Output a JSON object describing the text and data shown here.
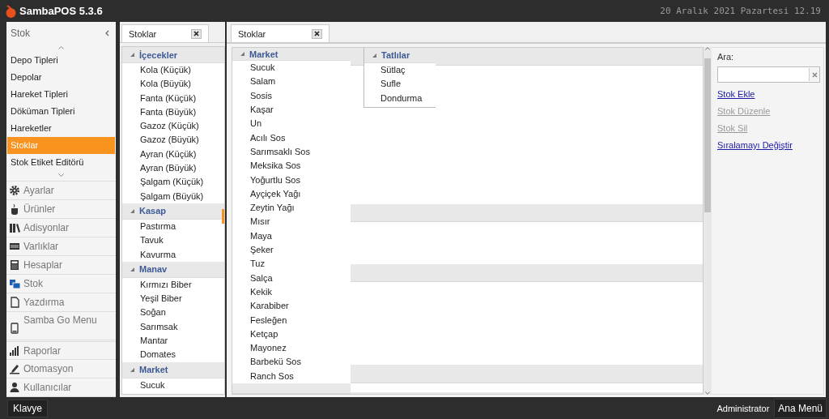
{
  "app": {
    "title": "SambaPOS 5.3.6",
    "datetime": "20 Aralık 2021 Pazartesi 12.19"
  },
  "sidebar": {
    "title": "Stok",
    "items": [
      {
        "label": "Depo Tipleri",
        "selected": false
      },
      {
        "label": "Depolar",
        "selected": false
      },
      {
        "label": "Hareket Tipleri",
        "selected": false
      },
      {
        "label": "Döküman Tipleri",
        "selected": false
      },
      {
        "label": "Hareketler",
        "selected": false
      },
      {
        "label": "Stoklar",
        "selected": true
      },
      {
        "label": "Stok Etiket Editörü",
        "selected": false
      }
    ],
    "nav": [
      {
        "label": "Ayarlar",
        "selected": false
      },
      {
        "label": "Ürünler",
        "selected": false
      },
      {
        "label": "Adisyonlar",
        "selected": false
      },
      {
        "label": "Varlıklar",
        "selected": false
      },
      {
        "label": "Hesaplar",
        "selected": false
      },
      {
        "label": "Stok",
        "selected": true
      },
      {
        "label": "Yazdırma",
        "selected": false
      },
      {
        "label": "Samba Go Menu",
        "selected": false
      },
      {
        "label": "Raporlar",
        "selected": false
      },
      {
        "label": "Otomasyon",
        "selected": false
      },
      {
        "label": "Kullanıcılar",
        "selected": false
      }
    ]
  },
  "left_panel": {
    "tab": {
      "label": "Stoklar"
    },
    "groups": [
      {
        "name": "İçecekler",
        "expanded": true,
        "items": [
          "Kola (Küçük)",
          "Kola (Büyük)",
          "Fanta (Küçük)",
          "Fanta (Büyük)",
          "Gazoz (Küçük)",
          "Gazoz (Büyük)",
          "Ayran (Küçük)",
          "Ayran (Büyük)",
          "Şalgam (Küçük)",
          "Şalgam (Büyük)"
        ]
      },
      {
        "name": "Kasap",
        "expanded": true,
        "items": [
          "Pastırma",
          "Tavuk",
          "Kavurma"
        ]
      },
      {
        "name": "Manav",
        "expanded": true,
        "items": [
          "Kırmızı Biber",
          "Yeşil Biber",
          "Soğan",
          "Sarımsak",
          "Mantar",
          "Domates"
        ]
      },
      {
        "name": "Market",
        "expanded": true,
        "items": [
          "Sucuk"
        ]
      }
    ]
  },
  "main_panel": {
    "tab": {
      "label": "Stoklar"
    },
    "market_group": {
      "name": "Market",
      "expanded": true,
      "items": [
        "Sucuk",
        "Salam",
        "Sosis",
        "Kaşar",
        "Un",
        "Acılı Sos",
        "Sarımsaklı Sos",
        "Meksika Sos",
        "Yoğurtlu Sos",
        "Ayçiçek Yağı",
        "Zeytin Yağı",
        "Mısır",
        "Maya",
        "Şeker",
        "Tuz",
        "Salça",
        "Kekik",
        "Karabiber",
        "Fesleğen",
        "Ketçap",
        "Mayonez",
        "Barbekü Sos",
        "Ranch Sos"
      ]
    },
    "dessert_group": {
      "name": "Tatlılar",
      "expanded": true,
      "items": [
        "Sütlaç",
        "Sufle",
        "Dondurma"
      ]
    },
    "search": {
      "label": "Ara:"
    },
    "actions": [
      {
        "label": "Stok Ekle",
        "disabled": false
      },
      {
        "label": "Stok Düzenle",
        "disabled": true
      },
      {
        "label": "Stok Sil",
        "disabled": true
      },
      {
        "label": "Sıralamayı Değiştir",
        "disabled": false
      }
    ]
  },
  "status_bar": {
    "keyboard": "Klavye",
    "user": "Administrator",
    "menu": "Ana Menü"
  }
}
